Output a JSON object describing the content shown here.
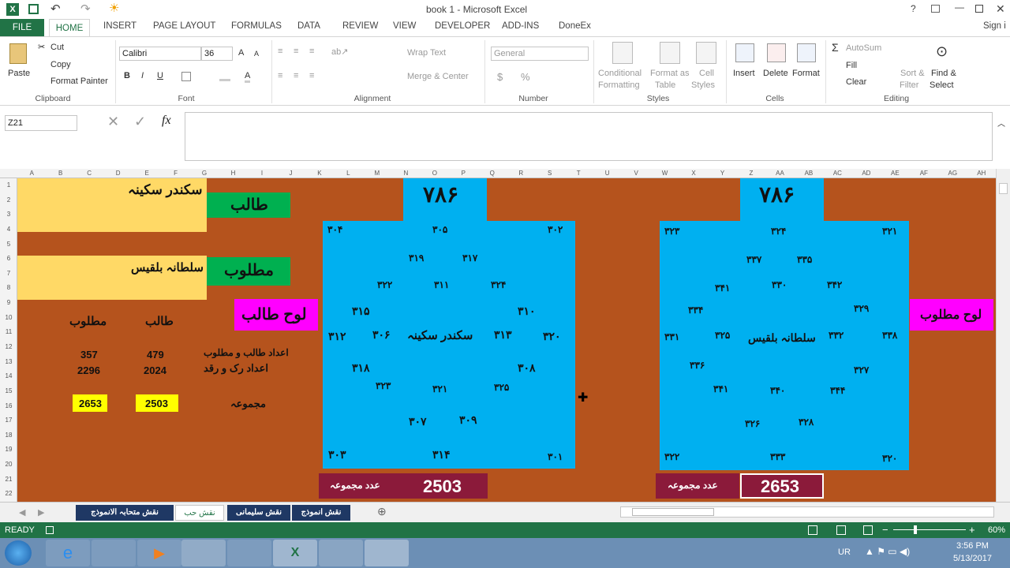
{
  "title": "book 1 - Microsoft Excel",
  "sign_in": "Sign i",
  "tabs": {
    "file": "FILE",
    "home": "HOME",
    "insert": "INSERT",
    "page_layout": "PAGE LAYOUT",
    "formulas": "FORMULAS",
    "data": "DATA",
    "review": "REVIEW",
    "view": "VIEW",
    "developer": "DEVELOPER",
    "addins": "ADD-INS",
    "doneex": "DoneEx"
  },
  "ribbon": {
    "paste": "Paste",
    "cut": "Cut",
    "copy": "Copy",
    "format_painter": "Format Painter",
    "clipboard": "Clipboard",
    "font_name": "Calibri",
    "font_size": "36",
    "font": "Font",
    "bold": "B",
    "italic": "I",
    "underline": "U",
    "wrap_text": "Wrap Text",
    "merge_center": "Merge & Center",
    "alignment": "Alignment",
    "number_format": "General",
    "number": "Number",
    "currency": "$",
    "percent": "%",
    "cond_fmt_1": "Conditional",
    "cond_fmt_2": "Formatting",
    "fmt_table_1": "Format as",
    "fmt_table_2": "Table",
    "cell_styles_1": "Cell",
    "cell_styles_2": "Styles",
    "styles": "Styles",
    "insert": "Insert",
    "delete": "Delete",
    "format": "Format",
    "cells": "Cells",
    "autosum": "AutoSum",
    "fill": "Fill",
    "clear": "Clear",
    "sort_1": "Sort &",
    "sort_2": "Filter",
    "find_1": "Find &",
    "find_2": "Select",
    "editing": "Editing"
  },
  "formula_bar": {
    "name_box": "Z21",
    "fx": "fx",
    "content": ""
  },
  "columns": [
    "A",
    "B",
    "C",
    "D",
    "E",
    "F",
    "G",
    "H",
    "I",
    "J",
    "K",
    "L",
    "M",
    "N",
    "O",
    "P",
    "Q",
    "R",
    "S",
    "T",
    "U",
    "V",
    "W",
    "X",
    "Y",
    "Z",
    "AA",
    "AB",
    "AC",
    "AD",
    "AE",
    "AF",
    "AG",
    "AH"
  ],
  "rows": [
    "1",
    "2",
    "3",
    "4",
    "5",
    "6",
    "7",
    "8",
    "9",
    "10",
    "11",
    "12",
    "13",
    "14",
    "15",
    "16",
    "17",
    "18",
    "19",
    "20",
    "21",
    "22"
  ],
  "sheet": {
    "name1": "سکندر سکینہ",
    "talib": "طالب",
    "name2": "سلطانہ بلقیس",
    "matloob": "مطلوب",
    "lauh_talib": "لوح طالب",
    "lauh_matloob": "لوح مطلوب",
    "hdr_matloob": "مطلوب",
    "hdr_talib": "طالب",
    "row1_label": "اعداد طالب و مطلوب",
    "row2_label": "اعداد رک و رقد",
    "total_label": "مجموعہ",
    "m1": "357",
    "t1": "479",
    "m2": "2296",
    "t2": "2024",
    "m_total": "2653",
    "t_total": "2503",
    "heading": "۷۸۶",
    "adad_label": "عدد مجموعہ",
    "left_sum": "2503",
    "right_sum": "2653",
    "left_grid": {
      "a": "۳۰۴",
      "b": "۳۰۵",
      "c": "۳۰۲",
      "d": "۳۱۹",
      "e": "۳۱۷",
      "f": "۳۲۲",
      "g": "۳۱۱",
      "h": "۳۲۴",
      "i": "۳۱۵",
      "j": "۳۱۰",
      "k": "۳۱۲",
      "l": "۳۰۶",
      "m": "سکندر سکینہ",
      "n": "۳۱۳",
      "o": "۳۲۰",
      "p": "۳۱۸",
      "q": "۳۰۸",
      "r": "۳۲۳",
      "s": "۳۲۱",
      "u": "۳۲۵",
      "v": "۳۰۷",
      "w": "۳۰۹",
      "x": "۳۰۳",
      "y": "۳۱۴",
      "z": "۳۰۱"
    },
    "right_grid": {
      "a": "۳۲۳",
      "b": "۳۲۴",
      "c": "۳۲۱",
      "d": "۳۳۷",
      "e": "۳۳۵",
      "f": "۳۴۱",
      "g": "۳۳۰",
      "h": "۳۴۲",
      "i": "۳۳۴",
      "j": "۳۲۹",
      "k": "۳۳۱",
      "l": "۳۲۵",
      "m": "سلطانہ بلقیس",
      "n": "۳۳۲",
      "o": "۳۳۸",
      "p": "۳۳۶",
      "q": "۳۲۷",
      "r": "۳۴۱",
      "s": "۳۴۰",
      "u": "۳۴۴",
      "v": "۳۲۶",
      "w": "۳۲۸",
      "x": "۳۲۲",
      "y": "۳۳۳",
      "z": "۳۲۰"
    }
  },
  "sheet_tabs": [
    "نقش متحابہ الانموذج",
    "نقش حب",
    "نقش سلیمانی",
    "نقش انموذج"
  ],
  "status": {
    "ready": "READY",
    "zoom": "60%"
  },
  "taskbar": {
    "lang": "UR",
    "time": "3:56 PM",
    "date": "5/13/2017"
  },
  "colors": {
    "excel_green": "#217346",
    "orange": "#b5531d",
    "blue": "#00b0f0",
    "green": "#00b050",
    "yellow_light": "#ffd966",
    "magenta": "#ff00ff",
    "maroon": "#8b1a3a",
    "yellow": "#ffff00"
  }
}
